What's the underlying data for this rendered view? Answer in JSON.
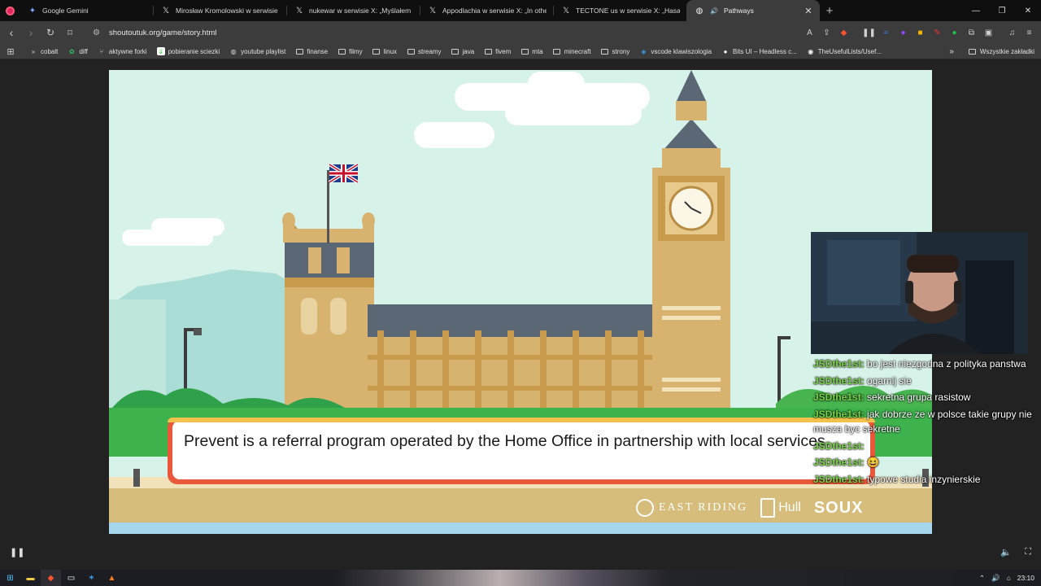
{
  "tabs": [
    {
      "title": "Google Gemini",
      "icon": "gemini-icon",
      "active": false
    },
    {
      "title": "Mirosław Kromolowski w serwisie X: ...",
      "icon": "x-logo-icon",
      "active": false
    },
    {
      "title": "nukewar w serwisie X: „Myślałem że t...",
      "icon": "x-logo-icon",
      "active": false
    },
    {
      "title": "Appodlachia w serwisie X: „In other c...",
      "icon": "x-logo-icon",
      "active": false
    },
    {
      "title": "TECTONE us w serwisie X: „Hasan sho...",
      "icon": "x-logo-icon",
      "active": false
    },
    {
      "title": "Pathways",
      "icon": "globe-icon",
      "active": true
    }
  ],
  "address": {
    "url": "shoutoutuk.org/game/story.html"
  },
  "bookmarks": [
    {
      "label": "cobalt",
      "icon": "cobalt-icon"
    },
    {
      "label": "diff",
      "icon": "diff-icon"
    },
    {
      "label": "aktywne forki",
      "icon": "fork-icon"
    },
    {
      "label": "pobieranie sciezki",
      "icon": "download-icon"
    },
    {
      "label": "youtube playlist",
      "icon": "globe-icon"
    },
    {
      "label": "finanse",
      "icon": "folder-icon"
    },
    {
      "label": "filmy",
      "icon": "folder-icon"
    },
    {
      "label": "linux",
      "icon": "folder-icon"
    },
    {
      "label": "streamy",
      "icon": "folder-icon"
    },
    {
      "label": "java",
      "icon": "folder-icon"
    },
    {
      "label": "fivem",
      "icon": "folder-icon"
    },
    {
      "label": "mta",
      "icon": "folder-icon"
    },
    {
      "label": "minecraft",
      "icon": "folder-icon"
    },
    {
      "label": "strony",
      "icon": "folder-icon"
    },
    {
      "label": "vscode klawiszologia",
      "icon": "vscode-icon"
    },
    {
      "label": "Bits UI – Headless c...",
      "icon": "circle-icon"
    },
    {
      "label": "TheUsefulLists/Usef...",
      "icon": "github-icon"
    }
  ],
  "bookmarks_all": "Wszystkie zakładki",
  "game": {
    "dialog_text": "Prevent is a referral program operated by the Home Office in partnership with local services.",
    "sponsor_east_riding": "EAST RIDING",
    "sponsor_hull": "Hull",
    "sponsor_soux": "SOUX"
  },
  "chat": [
    {
      "user": "JSDthe1st:",
      "text": "bo jest niezgodna z polityka panstwa"
    },
    {
      "user": "JSDthe1st:",
      "text": "ogarnij sie"
    },
    {
      "user": "JSDthe1st:",
      "text": "sekretna grupa rasistow"
    },
    {
      "user": "JSDthe1st:",
      "text": "jak dobrze ze w polsce takie grupy nie musza byc sekretne"
    },
    {
      "user": "JSDthe1st:",
      "text": ""
    },
    {
      "user": "JSDthe1st:",
      "text": "😆"
    },
    {
      "user": "JSDthe1st:",
      "text": "typowe studia inzynierskie"
    }
  ],
  "taskbar": {
    "time": "23:10"
  },
  "colors": {
    "accent": "#e9583b",
    "chat_user": "#7bd34a",
    "sky": "#d7f2e8"
  }
}
